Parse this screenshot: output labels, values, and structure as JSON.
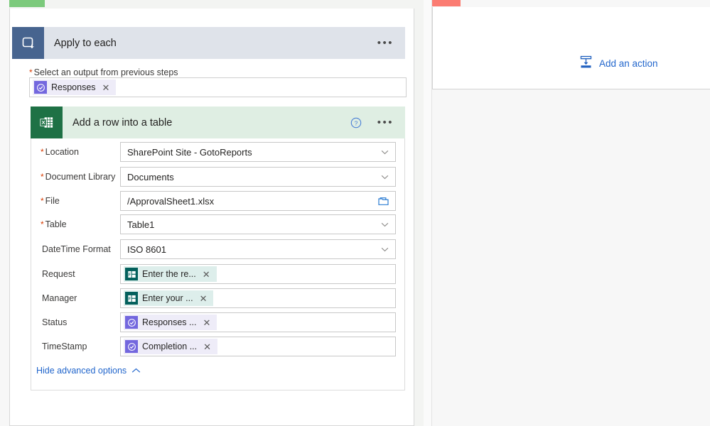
{
  "colors": {
    "apply_accent": "#7cca7c",
    "apply_header_bg": "#dfe3ea",
    "apply_icon_bg": "#47648f",
    "excel_header_bg": "#dfeee3",
    "excel_icon_bg": "#1e7145",
    "right_accent": "#fb7c72",
    "link_blue": "#2266cc",
    "required_red": "#d83b01",
    "approvals_token_bg": "#eeecf8",
    "approvals_icon_bg": "#7367de",
    "forms_token_bg": "#ddeeeb",
    "forms_icon_bg": "#03605c"
  },
  "apply_to_each": {
    "title": "Apply to each",
    "icon": "loop-icon",
    "menu_icon": "ellipsis-icon",
    "output_label": "Select an output from previous steps",
    "output_required": "*",
    "output_token": {
      "label": "Responses",
      "icon": "approvals-icon",
      "remove_icon": "close-icon",
      "source": "approvals"
    }
  },
  "excel_action": {
    "title": "Add a row into a table",
    "icon": "excel-icon",
    "help_icon": "help-circle-icon",
    "menu_icon": "ellipsis-icon",
    "fields": [
      {
        "label": "Location",
        "required": "*",
        "kind": "dropdown",
        "value": "SharePoint Site - GotoReports",
        "affordance_icon": "chevron-down-icon"
      },
      {
        "label": "Document Library",
        "required": "*",
        "kind": "dropdown",
        "value": "Documents",
        "affordance_icon": "chevron-down-icon"
      },
      {
        "label": "File",
        "required": "*",
        "kind": "filepicker",
        "value": "/ApprovalSheet1.xlsx",
        "affordance_icon": "folder-icon"
      },
      {
        "label": "Table",
        "required": "*",
        "kind": "dropdown",
        "value": "Table1",
        "affordance_icon": "chevron-down-icon"
      },
      {
        "label": "DateTime Format",
        "required": "",
        "kind": "dropdown",
        "value": "ISO 8601",
        "affordance_icon": "chevron-down-icon"
      },
      {
        "label": "Request",
        "required": "",
        "kind": "token",
        "token": {
          "label": "Enter the re...",
          "icon": "forms-icon",
          "remove_icon": "close-icon",
          "source": "forms"
        }
      },
      {
        "label": "Manager",
        "required": "",
        "kind": "token",
        "token": {
          "label": "Enter your ...",
          "icon": "forms-icon",
          "remove_icon": "close-icon",
          "source": "forms"
        }
      },
      {
        "label": "Status",
        "required": "",
        "kind": "token",
        "token": {
          "label": "Responses ...",
          "icon": "approvals-icon",
          "remove_icon": "close-icon",
          "source": "approvals"
        }
      },
      {
        "label": "TimeStamp",
        "required": "",
        "kind": "token",
        "token": {
          "label": "Completion ...",
          "icon": "approvals-icon",
          "remove_icon": "close-icon",
          "source": "approvals"
        }
      }
    ],
    "advanced_options": {
      "label": "Hide advanced options",
      "icon": "chevron-up-icon"
    }
  },
  "right_panel": {
    "add_action": {
      "label": "Add an action",
      "icon": "insert-step-icon"
    }
  }
}
